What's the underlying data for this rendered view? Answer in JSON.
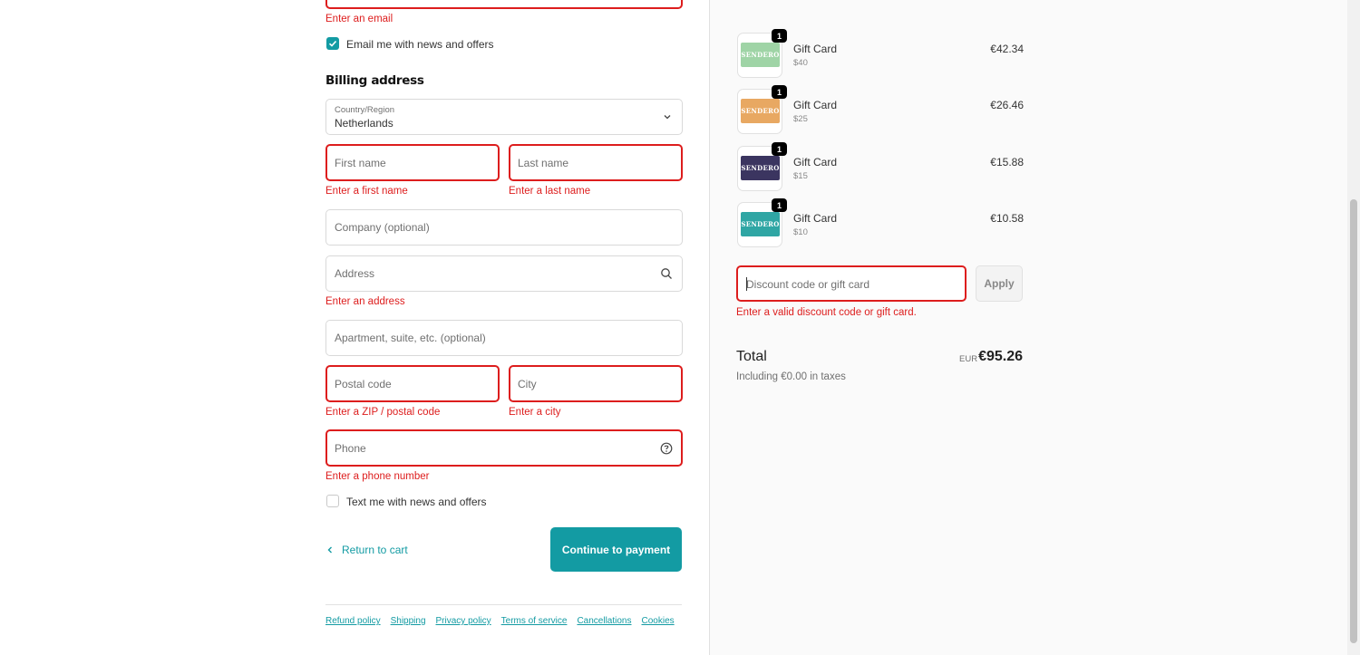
{
  "contact": {
    "email_error": "Enter an email",
    "email_news_label": "Email me with news and offers",
    "email_news_checked": true
  },
  "billing": {
    "heading": "Billing address",
    "country_label": "Country/Region",
    "country_value": "Netherlands",
    "first_name_placeholder": "First name",
    "first_name_error": "Enter a first name",
    "last_name_placeholder": "Last name",
    "last_name_error": "Enter a last name",
    "company_placeholder": "Company (optional)",
    "address_placeholder": "Address",
    "address_error": "Enter an address",
    "apartment_placeholder": "Apartment, suite, etc. (optional)",
    "postal_placeholder": "Postal code",
    "postal_error": "Enter a ZIP / postal code",
    "city_placeholder": "City",
    "city_error": "Enter a city",
    "phone_placeholder": "Phone",
    "phone_error": "Enter a phone number",
    "text_news_label": "Text me with news and offers",
    "text_news_checked": false
  },
  "actions": {
    "return_label": "Return to cart",
    "continue_label": "Continue to payment"
  },
  "footer": {
    "links": [
      "Refund policy",
      "Shipping",
      "Privacy policy",
      "Terms of service",
      "Cancellations",
      "Cookies"
    ]
  },
  "summary": {
    "items": [
      {
        "name": "Gift Card",
        "variant": "$40",
        "price": "€42.34",
        "qty": "1",
        "card_color": "#9fd4a6",
        "card_text": "SENDERO"
      },
      {
        "name": "Gift Card",
        "variant": "$25",
        "price": "€26.46",
        "qty": "1",
        "card_color": "#e8a862",
        "card_text": "SENDERO"
      },
      {
        "name": "Gift Card",
        "variant": "$15",
        "price": "€15.88",
        "qty": "1",
        "card_color": "#3b3560",
        "card_text": "SENDERO"
      },
      {
        "name": "Gift Card",
        "variant": "$10",
        "price": "€10.58",
        "qty": "1",
        "card_color": "#2fa6a4",
        "card_text": "SENDERO"
      }
    ],
    "discount_placeholder": "Discount code or gift card",
    "apply_label": "Apply",
    "discount_error": "Enter a valid discount code or gift card.",
    "total_label": "Total",
    "taxes_note": "Including €0.00 in taxes",
    "currency": "EUR",
    "total_value": "€95.26"
  },
  "colors": {
    "accent": "#139ba3",
    "error": "#dd1d1d"
  },
  "icons": [
    "check-icon",
    "chevron-down-icon",
    "search-icon",
    "help-circle-icon",
    "chevron-left-icon"
  ]
}
